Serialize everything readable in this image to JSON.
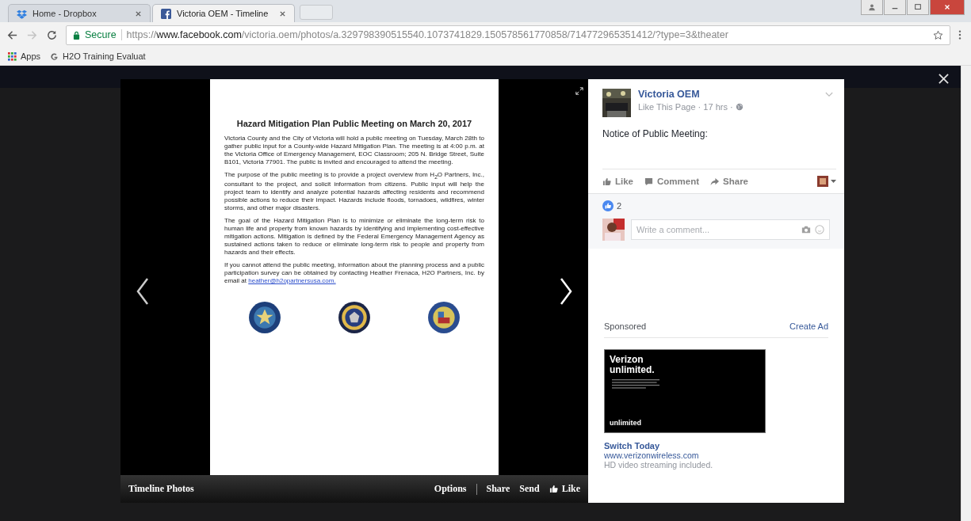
{
  "browser": {
    "tabs": [
      {
        "title": "Home - Dropbox",
        "selected": false
      },
      {
        "title": "Victoria OEM - Timeline",
        "selected": true
      }
    ],
    "address": {
      "secure_label": "Secure",
      "scheme": "https://",
      "host": "www.facebook.com",
      "path": "/victoria.oem/photos/a.329798390515540.1073741829.150578561770858/714772965351412/?type=3&theater"
    },
    "bookmarks": [
      "Apps",
      "H2O Training Evaluat"
    ]
  },
  "viewer": {
    "document": {
      "title": "Hazard Mitigation Plan Public Meeting on March 20, 2017",
      "paragraphs": [
        "Victoria County and the City of Victoria will hold a public meeting on Tuesday, March 28th to gather public input for a County-wide Hazard Mitigation Plan.  The meeting is at 4:00 p.m. at the Victoria Office of Emergency Management, EOC Classroom; 205 N. Bridge Street, Suite B101, Victoria 77901.  The public is invited and encouraged to attend the meeting.",
        "The purpose of the public meeting is to provide a project overview from H$_{2}$O Partners, Inc., consultant to the project, and solicit information from citizens. Public input will help the project team to identify and analyze potential hazards affecting residents and recommend possible actions to reduce their impact. Hazards include floods, tornadoes, wildfires, winter storms, and other major disasters.",
        "The goal of the Hazard Mitigation Plan is to minimize or eliminate the long-term risk to human life and property from known hazards by identifying and implementing cost-effective mitigation actions. Mitigation is defined by the Federal Emergency Management Agency as sustained actions taken to reduce or eliminate long-term risk to people and property from hazards and their effects.",
        "If you cannot attend the public meeting, information about the planning process and a public participation survey can be obtained by contacting Heather Frenaca, H2O Partners, Inc. by email at"
      ],
      "link": "heather@h2opartnersusa.com."
    },
    "caption": "Timeline Photos",
    "actions": [
      "Options",
      "Share",
      "Send",
      "Like"
    ]
  },
  "post": {
    "page_name": "Victoria OEM",
    "meta": "Like This Page · 17 hrs ·",
    "text": "Notice of Public Meeting:",
    "actions": [
      {
        "label": "Like",
        "kind": "like"
      },
      {
        "label": "Comment",
        "kind": "comment"
      },
      {
        "label": "Share",
        "kind": "share"
      }
    ],
    "reactions_count": "2",
    "comment_placeholder": "Write a comment..."
  },
  "sponsored": {
    "heading": "Sponsored",
    "create_ad": "Create Ad",
    "ad": {
      "image_title": "Verizon unlimited.",
      "image_footer": "unlimited",
      "headline": "Switch Today",
      "url": "www.verizonwireless.com",
      "description": "HD video streaming included."
    }
  }
}
